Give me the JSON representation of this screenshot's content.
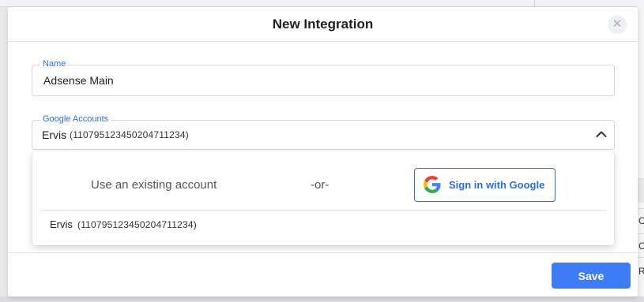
{
  "dialog": {
    "title": "New Integration",
    "close_icon": "close-icon"
  },
  "name_field": {
    "label": "Name",
    "value": "Adsense Main"
  },
  "accounts_field": {
    "label": "Google Accounts",
    "selected_name": "Ervis",
    "selected_id": "(110795123450204711234)",
    "toggle_icon": "chevron-up-icon"
  },
  "dropdown": {
    "existing_label": "Use an existing account",
    "or_label": "-or-",
    "google_button_label": "Sign in with Google",
    "google_icon": "google-logo-icon",
    "items": [
      {
        "name": "Ervis",
        "id": "(110795123450204711234)"
      }
    ]
  },
  "footer": {
    "save_label": "Save"
  },
  "background": {
    "right_edge_chars": [
      "C",
      "C",
      "R"
    ]
  },
  "colors": {
    "accent": "#3d7cf5",
    "link_blue": "#2f6fdc"
  }
}
